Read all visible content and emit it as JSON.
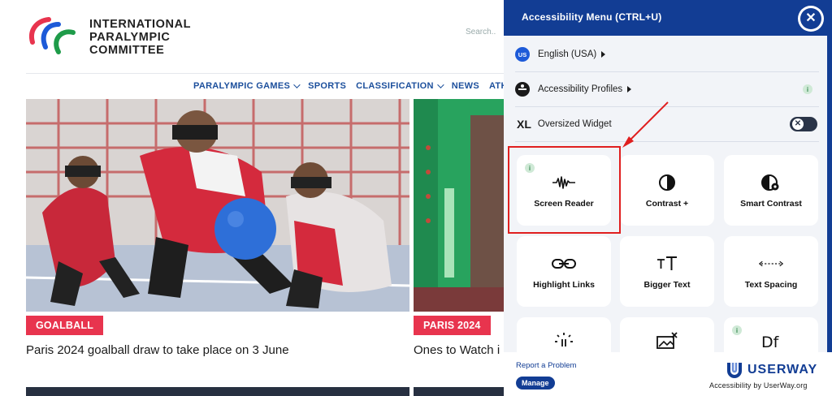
{
  "site": {
    "logo_lines": [
      "INTERNATIONAL",
      "PARALYMPIC",
      "COMMITTEE"
    ],
    "search_placeholder": "Search..",
    "nav": [
      {
        "label": "PARALYMPIC GAMES",
        "has_dropdown": true
      },
      {
        "label": "SPORTS",
        "has_dropdown": false
      },
      {
        "label": "CLASSIFICATION",
        "has_dropdown": true
      },
      {
        "label": "NEWS",
        "has_dropdown": false
      },
      {
        "label": "ATHLETE",
        "has_dropdown": false
      }
    ],
    "cards": [
      {
        "tag": "GOALBALL",
        "headline": "Paris 2024 goalball draw to take place on 3 June"
      },
      {
        "tag": "PARIS 2024",
        "headline": "Ones to Watch i"
      }
    ],
    "colors": {
      "nav": "#1c4f9c",
      "tag": "#e8344e"
    }
  },
  "panel": {
    "title": "Accessibility Menu (CTRL+U)",
    "close_icon": "close-icon",
    "language": {
      "badge": "US",
      "label": "English (USA)"
    },
    "profiles": {
      "label": "Accessibility Profiles"
    },
    "oversized": {
      "prefix": "XL",
      "label": "Oversized Widget",
      "enabled": false
    },
    "tiles": [
      {
        "label": "Screen Reader",
        "icon": "waveform-icon",
        "info": true
      },
      {
        "label": "Contrast +",
        "icon": "contrast-icon",
        "info": false
      },
      {
        "label": "Smart Contrast",
        "icon": "smart-contrast-icon",
        "info": false
      },
      {
        "label": "Highlight Links",
        "icon": "link-icon",
        "info": false
      },
      {
        "label": "Bigger Text",
        "icon": "text-size-icon",
        "info": false
      },
      {
        "label": "Text Spacing",
        "icon": "text-spacing-icon",
        "info": false
      },
      {
        "label": "",
        "icon": "pause-animation-icon",
        "info": false
      },
      {
        "label": "",
        "icon": "hide-images-icon",
        "info": false
      },
      {
        "label": "",
        "icon": "dyslexia-font-icon",
        "info": true
      }
    ],
    "footer": {
      "report": "Report a Problem",
      "manage": "Manage",
      "brand": "USERWAY",
      "brand_sub": "Accessibility by UserWay.org"
    },
    "colors": {
      "header": "#123d94",
      "background": "#f2f4f8"
    }
  }
}
